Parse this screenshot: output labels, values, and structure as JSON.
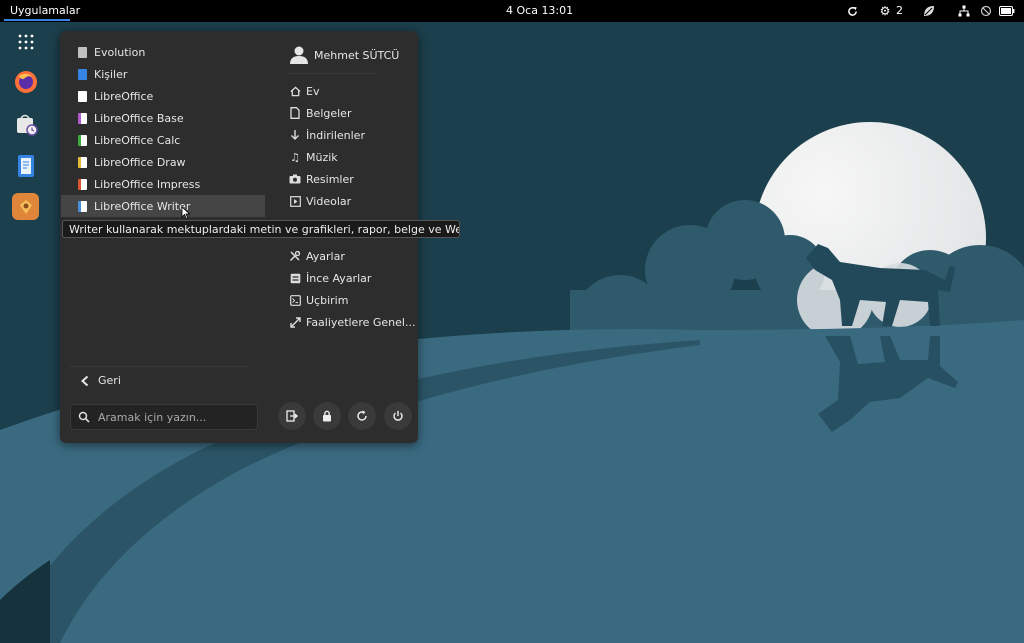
{
  "topbar": {
    "activities_label": "Uygulamalar",
    "clock": "4 Oca  13:01",
    "workspace_count": "2",
    "accent": "#3584e4"
  },
  "dash": {
    "items": [
      {
        "name": "show-apps",
        "icon": "grid-icon"
      },
      {
        "name": "firefox",
        "icon": "firefox-icon"
      },
      {
        "name": "software",
        "icon": "store-icon"
      },
      {
        "name": "text-editor",
        "icon": "notepad-icon"
      },
      {
        "name": "app-center",
        "icon": "package-icon"
      }
    ]
  },
  "menu": {
    "apps": [
      {
        "label": "Evolution",
        "icon_color": "#c0c0c0"
      },
      {
        "label": "Kişiler",
        "icon_color": "#3584e4"
      },
      {
        "label": "LibreOffice",
        "icon_color": "#ffffff"
      },
      {
        "label": "LibreOffice Base",
        "icon_color": "#b25bd1"
      },
      {
        "label": "LibreOffice Calc",
        "icon_color": "#3faa3f"
      },
      {
        "label": "LibreOffice Draw",
        "icon_color": "#e5b83a"
      },
      {
        "label": "LibreOffice Impress",
        "icon_color": "#d9562f"
      },
      {
        "label": "LibreOffice Writer",
        "icon_color": "#4a8ed8"
      }
    ],
    "user_name": "Mehmet SÜTCÜ",
    "places": [
      {
        "label": "Ev",
        "icon": "home-icon"
      },
      {
        "label": "Belgeler",
        "icon": "document-icon"
      },
      {
        "label": "İndirilenler",
        "icon": "download-icon"
      },
      {
        "label": "Müzik",
        "icon": "music-icon"
      },
      {
        "label": "Resimler",
        "icon": "camera-icon"
      },
      {
        "label": "Videolar",
        "icon": "video-icon"
      }
    ],
    "tools": [
      {
        "label": "Ayarlar",
        "icon": "settings-icon"
      },
      {
        "label": "İnce Ayarlar",
        "icon": "tweaks-icon"
      },
      {
        "label": "Uçbirim",
        "icon": "terminal-icon"
      },
      {
        "label": "Faaliyetlere Genel...",
        "icon": "expand-icon"
      }
    ],
    "back_label": "Geri",
    "search_placeholder": "Aramak için yazın...",
    "system_buttons": [
      "logout-icon",
      "lock-icon",
      "restart-icon",
      "power-icon"
    ]
  },
  "tooltip": "Writer kullanarak mektuplardaki metin ve grafikleri, rapor, belge ve Web sayfaları ...",
  "colors": {
    "sky": "#1b3f4c",
    "hill": "#3a6a80",
    "moon": "#f4f4f4",
    "menu_bg": "#2d2d2d"
  }
}
